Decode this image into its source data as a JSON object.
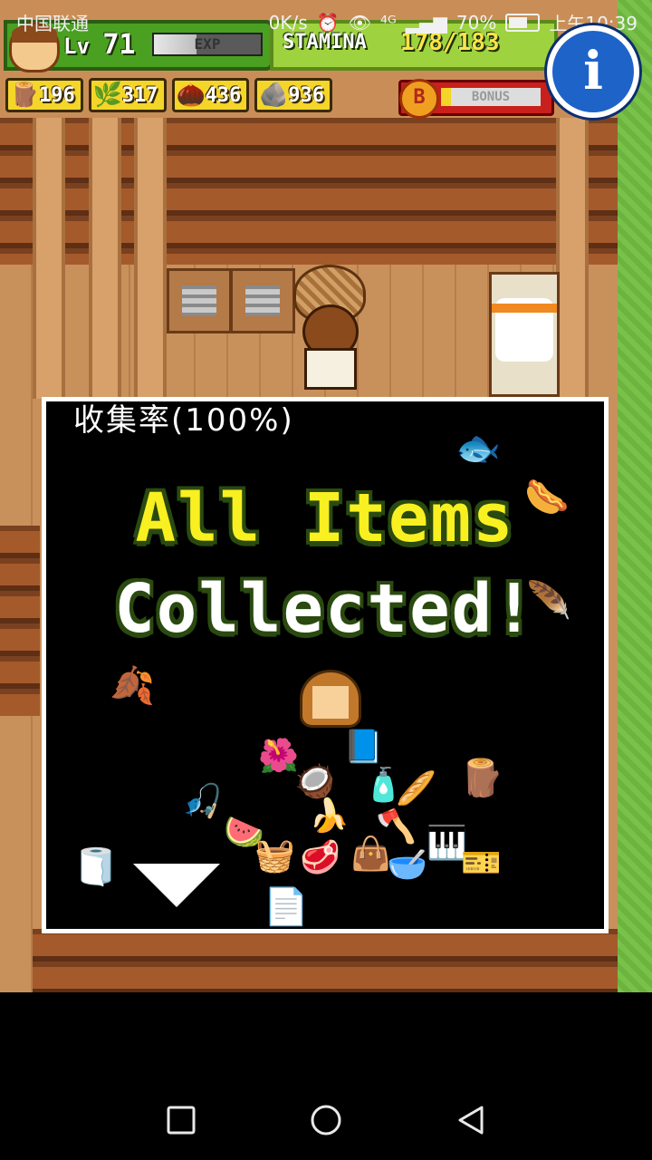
{
  "status_bar": {
    "carrier": "中国联通",
    "speed": "0K/s",
    "signal": "⁴ᴳ",
    "battery": "70%",
    "time": "上午10:39"
  },
  "hud": {
    "level_prefix": "Lv",
    "level": "71",
    "exp_label": "EXP",
    "exp_fraction": 0.4,
    "stamina_label": "STAMINA",
    "stamina_value": "178/183",
    "info_label": "i",
    "resources": [
      {
        "icon": "branch-icon",
        "glyph": "🪵",
        "value": "196"
      },
      {
        "icon": "herb-icon",
        "glyph": "🌿",
        "value": "317"
      },
      {
        "icon": "nut-icon",
        "glyph": "🌰",
        "value": "436"
      },
      {
        "icon": "stone-icon",
        "glyph": "🪨",
        "value": "936"
      }
    ],
    "bonus_coin": "B",
    "bonus_label": "BONUS",
    "bonus_fraction": 0.1
  },
  "dialog": {
    "collection_rate": "收集率(100%)",
    "headline_line1": "All Items",
    "headline_line2": "Collected!"
  },
  "colors": {
    "grass": "#79c24a",
    "headline_yellow": "#f8f020",
    "info_blue": "#1e63c8"
  }
}
